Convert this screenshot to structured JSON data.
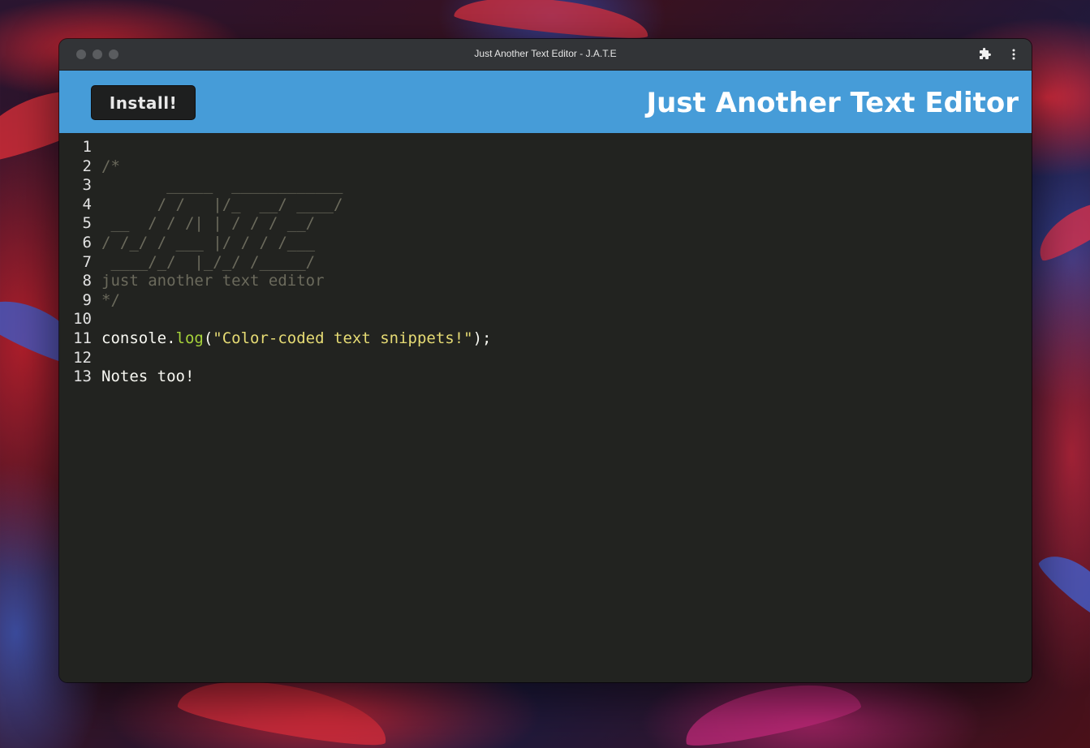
{
  "window": {
    "title": "Just Another Text Editor - J.A.T.E",
    "extensions_icon": "puzzle-icon",
    "menu_icon": "kebab-menu-icon"
  },
  "header": {
    "install_label": "Install!",
    "app_title": "Just Another Text Editor"
  },
  "colors": {
    "header_bg": "#469cd8",
    "editor_bg": "#222320",
    "comment": "#6b6a5c",
    "function": "#a6d23a",
    "string": "#e6db74",
    "plain": "#f8f8f2"
  },
  "editor": {
    "line_numbers": [
      "1",
      "2",
      "3",
      "4",
      "5",
      "6",
      "7",
      "8",
      "9",
      "10",
      "11",
      "12",
      "13"
    ],
    "lines": [
      [],
      [
        {
          "t": "/*",
          "c": "comment"
        }
      ],
      [
        {
          "t": "       _____  ____________",
          "c": "comment"
        }
      ],
      [
        {
          "t": "      / /   |/_  __/ ____/",
          "c": "comment"
        }
      ],
      [
        {
          "t": " __  / / /| | / / / __/",
          "c": "comment"
        }
      ],
      [
        {
          "t": "/ /_/ / ___ |/ / / /___",
          "c": "comment"
        }
      ],
      [
        {
          "t": " ____/_/  |_/_/ /_____/",
          "c": "comment"
        }
      ],
      [
        {
          "t": "just another text editor",
          "c": "comment"
        }
      ],
      [
        {
          "t": "*/",
          "c": "comment"
        }
      ],
      [],
      [
        {
          "t": "console.",
          "c": "text"
        },
        {
          "t": "log",
          "c": "fn"
        },
        {
          "t": "(",
          "c": "text"
        },
        {
          "t": "\"Color-coded text snippets!\"",
          "c": "str"
        },
        {
          "t": ");",
          "c": "text"
        }
      ],
      [],
      [
        {
          "t": "Notes too!",
          "c": "text"
        }
      ]
    ]
  }
}
